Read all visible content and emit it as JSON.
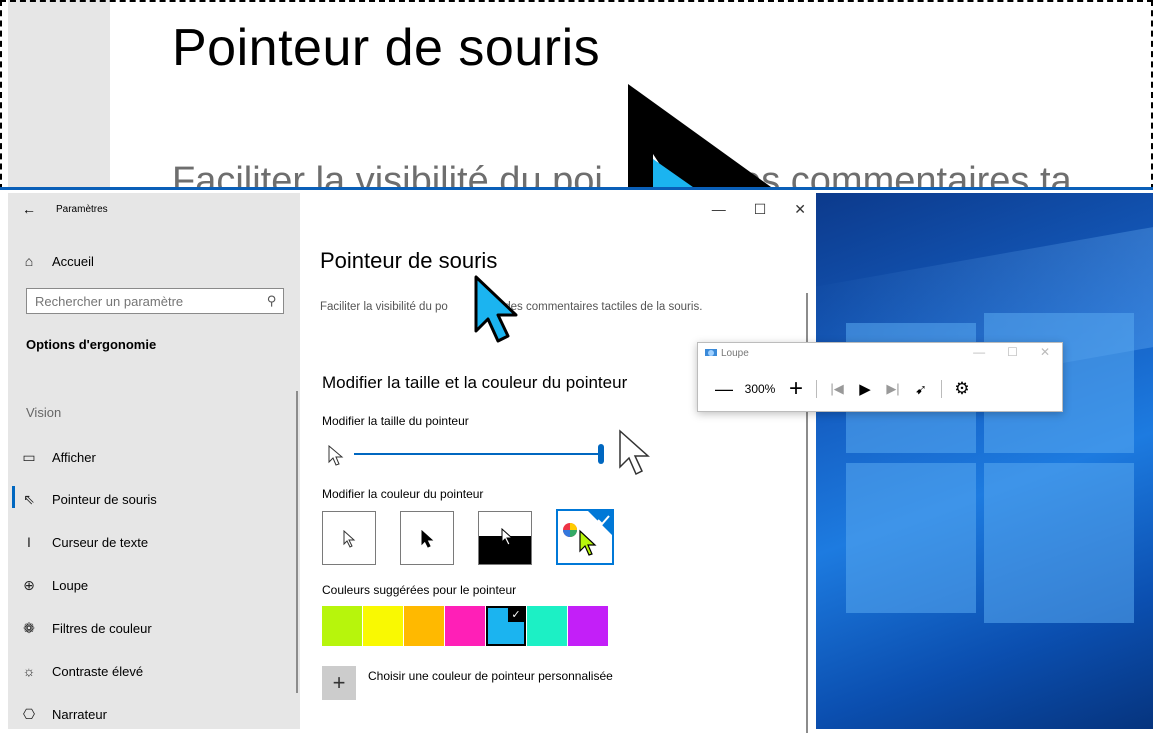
{
  "magnifier_view": {
    "title": "Pointeur de souris",
    "subtitle": "Faciliter la visibilité du poi           des commentaires ta"
  },
  "settings": {
    "header": {
      "back_label": "Paramètres",
      "min": "—",
      "max": "☐",
      "close": "✕"
    },
    "sidebar": {
      "home_label": "Accueil",
      "search_placeholder": "Rechercher un paramètre",
      "group_title": "Options d'ergonomie",
      "section_label": "Vision",
      "items": [
        {
          "label": "Afficher",
          "icon": "display-icon"
        },
        {
          "label": "Pointeur de souris",
          "icon": "mouse-pointer-icon"
        },
        {
          "label": "Curseur de texte",
          "icon": "text-cursor-icon"
        },
        {
          "label": "Loupe",
          "icon": "magnifier-icon"
        },
        {
          "label": "Filtres de couleur",
          "icon": "color-filter-icon"
        },
        {
          "label": "Contraste élevé",
          "icon": "brightness-icon"
        },
        {
          "label": "Narrateur",
          "icon": "narrator-icon"
        }
      ]
    },
    "main": {
      "title": "Pointeur de souris",
      "description_part1": "Faciliter la visibilité du po",
      "description_part2": "des commentaires tactiles de la souris.",
      "section_title": "Modifier la taille et la couleur du pointeur",
      "size_label": "Modifier la taille du pointeur",
      "size_value_fraction": 1.0,
      "color_label": "Modifier la couleur du pointeur",
      "color_options": [
        "white",
        "black",
        "inverted",
        "custom"
      ],
      "selected_color_option": "custom",
      "suggested_label": "Couleurs suggérées pour le pointeur",
      "suggested_colors": [
        "#b7f50c",
        "#f9f902",
        "#ffb900",
        "#ff1fb7",
        "#1bb4f0",
        "#1cf0c5",
        "#c31ff8"
      ],
      "selected_suggested_index": 4,
      "custom_color_label": "Choisir une couleur de pointeur personnalisée",
      "custom_color_plus": "+"
    }
  },
  "loupe": {
    "title": "Loupe",
    "zoom_out": "—",
    "zoom": "300%",
    "zoom_in": "+",
    "min": "—",
    "max": "☐",
    "close": "✕"
  },
  "colors": {
    "accent": "#0067c0",
    "cursor_fill": "#1bb4f0",
    "sidebar_bg": "#e6e6e6"
  }
}
